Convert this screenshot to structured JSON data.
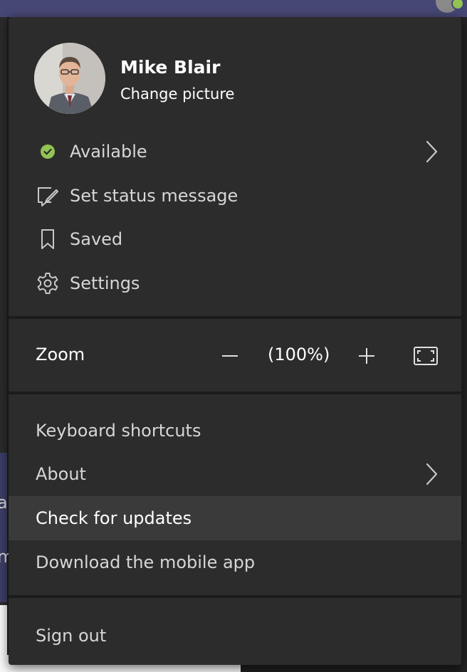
{
  "profile": {
    "name": "Mike Blair",
    "change_picture": "Change picture"
  },
  "status": {
    "label": "Available",
    "color": "#92c353"
  },
  "menu": {
    "set_status": "Set status message",
    "saved": "Saved",
    "settings": "Settings",
    "keyboard_shortcuts": "Keyboard shortcuts",
    "about": "About",
    "check_updates": "Check for updates",
    "download_mobile": "Download the mobile app",
    "sign_out": "Sign out"
  },
  "zoom": {
    "label": "Zoom",
    "value": "(100%)"
  },
  "background": {
    "left_letters": [
      "a",
      "m"
    ]
  },
  "colors": {
    "menu_bg": "#2d2c2c",
    "topbar": "#464775",
    "highlight": "#3b3a3a"
  },
  "icons": [
    "presence-available-icon",
    "edit-status-icon",
    "bookmark-icon",
    "gear-icon",
    "chevron-right-icon",
    "zoom-minus-icon",
    "zoom-plus-icon",
    "fit-screen-icon"
  ]
}
